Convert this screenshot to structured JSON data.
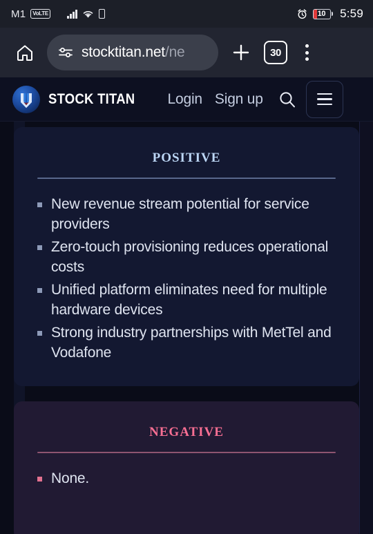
{
  "statusbar": {
    "carrier": "M1",
    "volte_label": "VoLTE",
    "signal_icon": "signal-bars-icon",
    "wifi_icon": "wifi-icon",
    "sim_icon": "sim-card-icon",
    "alarm_icon": "alarm-clock-icon",
    "battery_percent": "10",
    "time": "5:59"
  },
  "browser": {
    "home_icon": "home-icon",
    "tune_icon": "site-settings-tune-icon",
    "url_visible": "stocktitan.net",
    "url_truncated": "/ne",
    "new_tab_icon": "plus-icon",
    "tab_count": "30",
    "overflow_icon": "three-dot-menu-icon"
  },
  "site_header": {
    "logo_icon": "stock-titan-logo-icon",
    "brand": "STOCK TITAN",
    "links": [
      {
        "label": "Login"
      },
      {
        "label": "Sign up"
      }
    ],
    "search_icon": "search-icon",
    "hamburger_icon": "hamburger-menu-icon"
  },
  "main": {
    "cards": [
      {
        "id": "positive",
        "title": "Positive",
        "accent": "#bcd6f5",
        "bullets": [
          "New revenue stream potential for service providers",
          "Zero-touch provisioning reduces operational costs",
          "Unified platform eliminates need for multiple hardware devices",
          "Strong industry partnerships with MetTel and Vodafone"
        ]
      },
      {
        "id": "negative",
        "title": "Negative",
        "accent": "#f86f93",
        "bullets": [
          "None."
        ]
      }
    ]
  }
}
